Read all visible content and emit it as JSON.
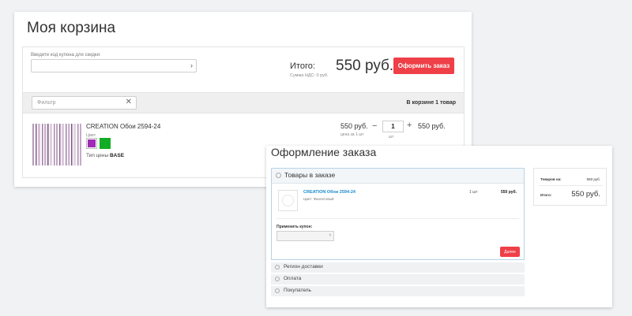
{
  "cart": {
    "title": "Моя корзина",
    "coupon_hint": "Введите код купона для скидки:",
    "coupon_arrow": "›",
    "total_label": "Итого:",
    "vat_label": "Сумма НДС: 0 руб.",
    "total_amount": "550 руб.",
    "order_button": "Оформить заказ",
    "filter_placeholder": "Фильтр",
    "filter_clear": "✕",
    "in_cart_count": "В корзине 1 товар",
    "item": {
      "name": "CREATION Обои 2594-24",
      "color_label": "Цвет",
      "colors": [
        "#a02bb8",
        "#12ad24"
      ],
      "price_type_label": "Тип цены",
      "price_type_value": "BASE",
      "unit_price": "550 руб.",
      "unit_price_sub": "цена за 1 шт",
      "qty_minus": "−",
      "quantity": "1",
      "qty_plus": "+",
      "qty_unit": "шт",
      "line_total": "550 руб."
    }
  },
  "checkout": {
    "title": "Оформление заказа",
    "goods_section_title": "Товары в заказе",
    "item": {
      "name": "CREATION Обои 2594-24",
      "color": "Цвет: Фиолетовый",
      "quantity": "1 шт",
      "price": "550 руб."
    },
    "coupon_label": "Применить купон:",
    "coupon_arrow": "›",
    "next_button": "Далее",
    "sections": [
      "Регион доставки",
      "Оплата",
      "Покупатель"
    ],
    "summary": {
      "goods_label": "Товаров на:",
      "goods_value": "550 руб.",
      "total_label": "Итого:",
      "total_value": "550 руб."
    }
  },
  "colors": {
    "accent_red": "#ef3f47",
    "link_blue": "#1a8ccf",
    "page_bg": "#f1f2f4"
  }
}
